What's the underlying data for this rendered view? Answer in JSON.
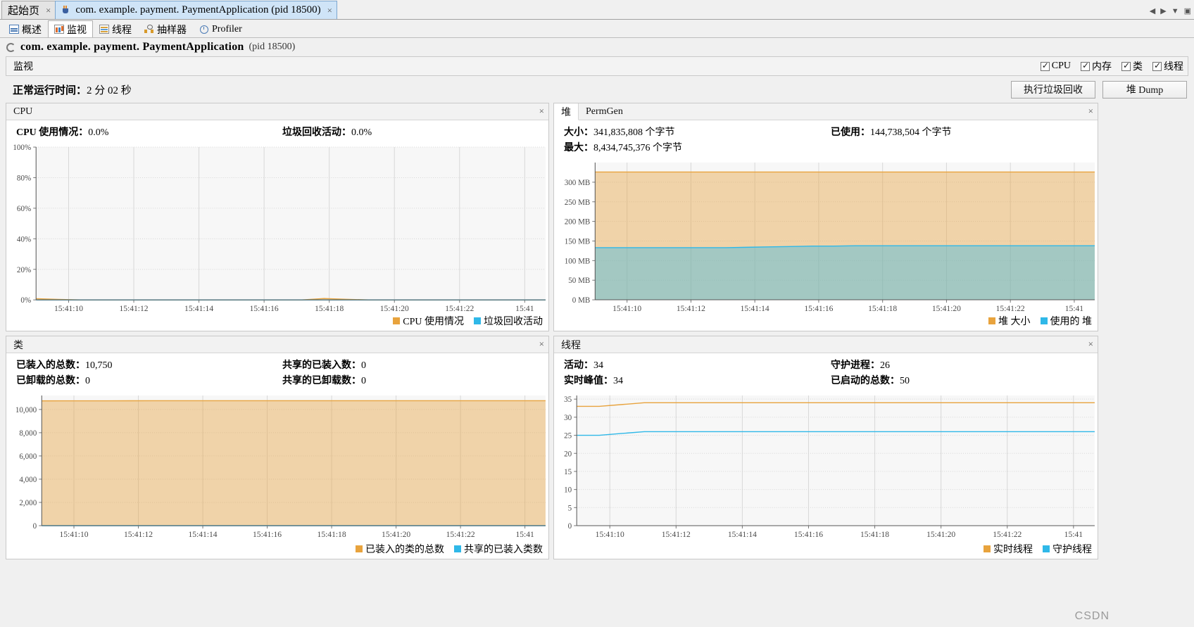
{
  "window": {
    "tabs": [
      {
        "label": "起始页",
        "icon": "none",
        "active": false,
        "close": "×"
      },
      {
        "label": "com. example. payment. PaymentApplication  (pid 18500)",
        "icon": "java-cup-icon",
        "active": true,
        "close": "×"
      }
    ],
    "tabstrip_controls": [
      "◀",
      "▶",
      "▼",
      "▣"
    ]
  },
  "view_tabs": [
    {
      "label": "概述",
      "icon": "overview-icon",
      "active": false
    },
    {
      "label": "监视",
      "icon": "monitor-icon",
      "active": true
    },
    {
      "label": "线程",
      "icon": "threads-icon",
      "active": false
    },
    {
      "label": "抽样器",
      "icon": "sampler-icon",
      "active": false
    },
    {
      "label": "Profiler",
      "icon": "profiler-icon",
      "active": false
    }
  ],
  "app_header": {
    "name": "com. example. payment. PaymentApplication",
    "pid": "(pid 18500)"
  },
  "monitor_bar": {
    "title": "监视",
    "checkboxes": [
      {
        "label": "CPU",
        "checked": true
      },
      {
        "label": "内存",
        "checked": true
      },
      {
        "label": "类",
        "checked": true
      },
      {
        "label": "线程",
        "checked": true
      }
    ]
  },
  "uptime": {
    "label": "正常运行时间：",
    "value": "2 分 02 秒"
  },
  "buttons": {
    "gc": "执行垃圾回收",
    "heap_dump": "堆 Dump"
  },
  "cpu_panel": {
    "title": "CPU",
    "close": "×",
    "stats": [
      {
        "label": "CPU 使用情况：",
        "value": "0.0%"
      },
      {
        "label": "垃圾回收活动：",
        "value": "0.0%"
      }
    ],
    "legend": [
      {
        "label": "CPU 使用情况",
        "color": "#e8a33d"
      },
      {
        "label": "垃圾回收活动",
        "color": "#2fb8e8"
      }
    ]
  },
  "heap_panel": {
    "tabs": [
      {
        "label": "堆",
        "active": true
      },
      {
        "label": "PermGen",
        "active": false
      }
    ],
    "close": "×",
    "stats": [
      {
        "label": "大小：",
        "value": "341,835,808 个字节"
      },
      {
        "label": "已使用：",
        "value": "144,738,504 个字节"
      },
      {
        "label": "最大：",
        "value": "8,434,745,376 个字节"
      }
    ],
    "legend": [
      {
        "label": "堆 大小",
        "color": "#e8a33d"
      },
      {
        "label": "使用的 堆",
        "color": "#2fb8e8"
      }
    ]
  },
  "classes_panel": {
    "title": "类",
    "close": "×",
    "stats": [
      {
        "label": "已装入的总数：",
        "value": "10,750"
      },
      {
        "label": "共享的已装入数：",
        "value": "0"
      },
      {
        "label": "已卸载的总数：",
        "value": "0"
      },
      {
        "label": "共享的已卸载数：",
        "value": "0"
      }
    ],
    "legend": [
      {
        "label": "已装入的类的总数",
        "color": "#e8a33d"
      },
      {
        "label": "共享的已装入类数",
        "color": "#2fb8e8"
      }
    ]
  },
  "threads_panel": {
    "title": "线程",
    "close": "×",
    "stats": [
      {
        "label": "活动：",
        "value": "34"
      },
      {
        "label": "守护进程：",
        "value": "26"
      },
      {
        "label": "实时峰值：",
        "value": "34"
      },
      {
        "label": "已启动的总数：",
        "value": "50"
      }
    ],
    "legend": [
      {
        "label": "实时线程",
        "color": "#e8a33d"
      },
      {
        "label": "守护线程",
        "color": "#2fb8e8"
      }
    ]
  },
  "watermark": "CSDN",
  "chart_data": [
    {
      "id": "cpu",
      "type": "area",
      "title": "CPU",
      "xlabel": "",
      "ylabel": "",
      "ylim": [
        0,
        100
      ],
      "yticks": [
        "0%",
        "20%",
        "40%",
        "60%",
        "80%",
        "100%"
      ],
      "ytick_values": [
        0,
        20,
        40,
        60,
        80,
        100
      ],
      "xticks": [
        "15:41:10",
        "15:41:12",
        "15:41:14",
        "15:41:16",
        "15:41:18",
        "15:41:20",
        "15:41:22",
        "15:41"
      ],
      "grid": true,
      "legend_position": "bottom-right",
      "series": [
        {
          "name": "CPU 使用情况",
          "color": "#e8a33d",
          "values": [
            0.8,
            0.3,
            0,
            0,
            0,
            0,
            0,
            0,
            0,
            0,
            0,
            0,
            0,
            0.9,
            0.4,
            0,
            0,
            0,
            0,
            0,
            0,
            0,
            0,
            0
          ]
        },
        {
          "name": "垃圾回收活动",
          "color": "#2fb8e8",
          "values": [
            0,
            0,
            0,
            0,
            0,
            0,
            0,
            0,
            0,
            0,
            0,
            0,
            0,
            0,
            0,
            0,
            0,
            0,
            0,
            0,
            0,
            0,
            0,
            0
          ]
        }
      ]
    },
    {
      "id": "heap",
      "type": "area",
      "title": "堆",
      "xlabel": "",
      "ylabel": "",
      "ylim": [
        0,
        350
      ],
      "yticks": [
        "0 MB",
        "50 MB",
        "100 MB",
        "150 MB",
        "200 MB",
        "250 MB",
        "300 MB"
      ],
      "ytick_values": [
        0,
        50,
        100,
        150,
        200,
        250,
        300
      ],
      "xticks": [
        "15:41:10",
        "15:41:12",
        "15:41:14",
        "15:41:16",
        "15:41:18",
        "15:41:20",
        "15:41:22",
        "15:41"
      ],
      "grid": true,
      "legend_position": "bottom-right",
      "series": [
        {
          "name": "堆 大小",
          "color": "#e8a33d",
          "values": [
            326,
            326,
            326,
            326,
            326,
            326,
            326,
            326,
            326,
            326,
            326,
            326,
            326,
            326,
            326,
            326,
            326,
            326,
            326,
            326,
            326,
            326,
            326,
            326
          ]
        },
        {
          "name": "使用的 堆",
          "color": "#2fb8e8",
          "values": [
            133,
            133,
            133,
            133,
            133,
            133,
            133,
            134,
            135,
            136,
            137,
            137,
            138,
            138,
            138,
            138,
            138,
            138,
            138,
            138,
            138,
            138,
            138,
            138
          ]
        }
      ]
    },
    {
      "id": "classes",
      "type": "area",
      "title": "类",
      "xlabel": "",
      "ylabel": "",
      "ylim": [
        0,
        11200
      ],
      "yticks": [
        "0",
        "2,000",
        "4,000",
        "6,000",
        "8,000",
        "10,000"
      ],
      "ytick_values": [
        0,
        2000,
        4000,
        6000,
        8000,
        10000
      ],
      "xticks": [
        "15:41:10",
        "15:41:12",
        "15:41:14",
        "15:41:16",
        "15:41:18",
        "15:41:20",
        "15:41:22",
        "15:41"
      ],
      "grid": true,
      "legend_position": "bottom-right",
      "series": [
        {
          "name": "已装入的类的总数",
          "color": "#e8a33d",
          "values": [
            10740,
            10742,
            10744,
            10746,
            10748,
            10750,
            10750,
            10750,
            10750,
            10750,
            10750,
            10750,
            10750,
            10750,
            10750,
            10750,
            10750,
            10750,
            10750,
            10750,
            10750,
            10750,
            10750,
            10750
          ]
        },
        {
          "name": "共享的已装入类数",
          "color": "#2fb8e8",
          "values": [
            0,
            0,
            0,
            0,
            0,
            0,
            0,
            0,
            0,
            0,
            0,
            0,
            0,
            0,
            0,
            0,
            0,
            0,
            0,
            0,
            0,
            0,
            0,
            0
          ]
        }
      ]
    },
    {
      "id": "threads",
      "type": "line",
      "title": "线程",
      "xlabel": "",
      "ylabel": "",
      "ylim": [
        0,
        36
      ],
      "yticks": [
        "0",
        "5",
        "10",
        "15",
        "20",
        "25",
        "30",
        "35"
      ],
      "ytick_values": [
        0,
        5,
        10,
        15,
        20,
        25,
        30,
        35
      ],
      "xticks": [
        "15:41:10",
        "15:41:12",
        "15:41:14",
        "15:41:16",
        "15:41:18",
        "15:41:20",
        "15:41:22",
        "15:41"
      ],
      "grid": true,
      "legend_position": "bottom-right",
      "series": [
        {
          "name": "实时线程",
          "color": "#e8a33d",
          "values": [
            33,
            33,
            33.5,
            34,
            34,
            34,
            34,
            34,
            34,
            34,
            34,
            34,
            34,
            34,
            34,
            34,
            34,
            34,
            34,
            34,
            34,
            34,
            34,
            34
          ]
        },
        {
          "name": "守护线程",
          "color": "#2fb8e8",
          "values": [
            25,
            25,
            25.5,
            26,
            26,
            26,
            26,
            26,
            26,
            26,
            26,
            26,
            26,
            26,
            26,
            26,
            26,
            26,
            26,
            26,
            26,
            26,
            26,
            26
          ]
        }
      ]
    }
  ]
}
